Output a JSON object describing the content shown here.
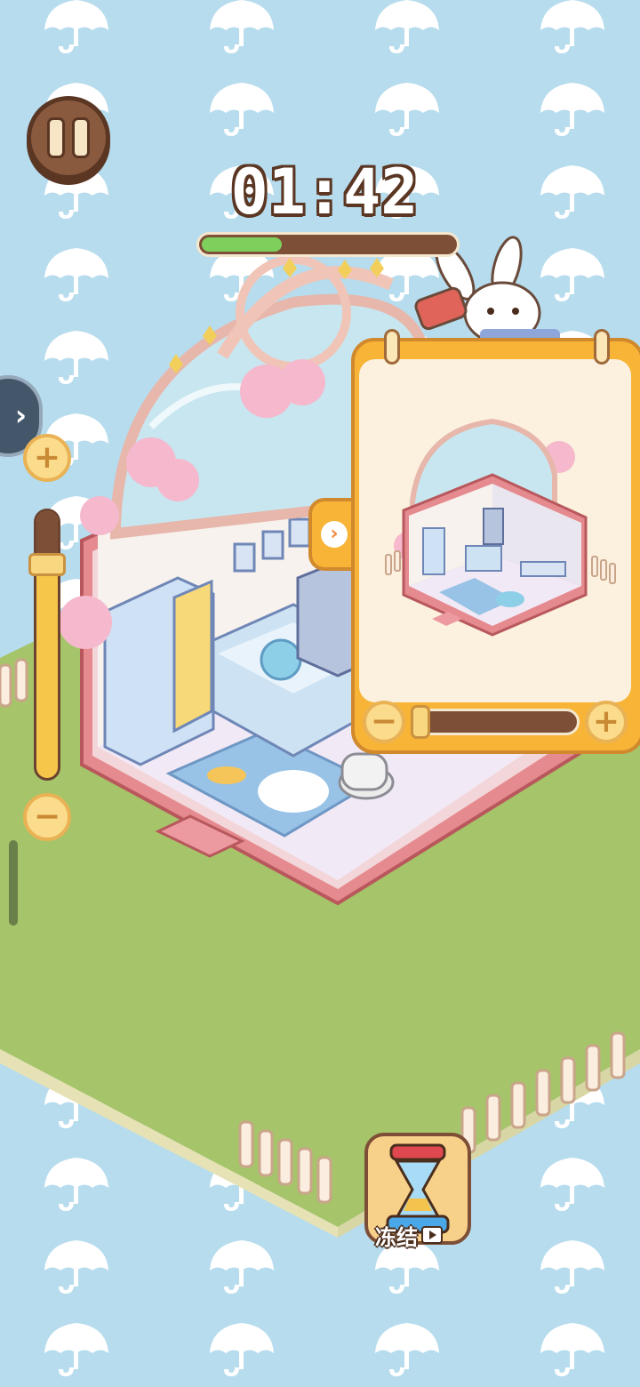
{
  "hud": {
    "timer": "01:42",
    "timer_progress": 0.33
  },
  "zoom": {
    "level": 0.2
  },
  "target_card": {
    "zoom_level": 0.05
  },
  "booster": {
    "label": "冻结"
  },
  "colors": {
    "background": "#b6dced",
    "grass": "#a6c469",
    "card": "#f7b437",
    "wood": "#7e4f37",
    "timer_fill": "#7ed05c"
  },
  "icons": {
    "pause": "pause-icon",
    "expand": "chevron-right-icon",
    "collapse": "chevron-right-icon",
    "freeze": "hourglass-icon",
    "ad": "video-icon"
  }
}
